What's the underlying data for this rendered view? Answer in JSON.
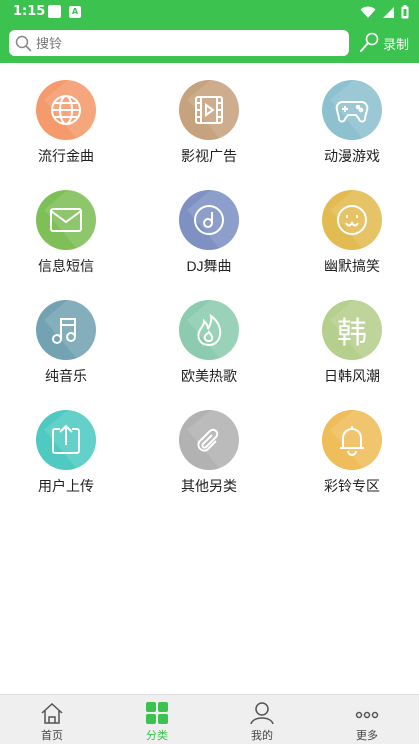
{
  "status_bar": {
    "time": "1:15",
    "notif_badge": "A"
  },
  "search": {
    "placeholder": "搜铃",
    "record_label": "录制"
  },
  "colors": {
    "brand": "#3cc24f",
    "active_nav": "#3cc24f"
  },
  "categories": [
    {
      "label": "流行金曲",
      "icon": "globe-icon",
      "color": "#f59a6c"
    },
    {
      "label": "影视广告",
      "icon": "film-icon",
      "color": "#c6a27f"
    },
    {
      "label": "动漫游戏",
      "icon": "gamepad-icon",
      "color": "#8ec1cf"
    },
    {
      "label": "信息短信",
      "icon": "mail-icon",
      "color": "#7fbf57"
    },
    {
      "label": "DJ舞曲",
      "icon": "disc-icon",
      "color": "#7f91c3"
    },
    {
      "label": "幽默搞笑",
      "icon": "smiley-icon",
      "color": "#e3bb53"
    },
    {
      "label": "纯音乐",
      "icon": "music-note-icon",
      "color": "#73a3b3"
    },
    {
      "label": "欧美热歌",
      "icon": "flame-icon",
      "color": "#8ccbb0"
    },
    {
      "label": "日韩风潮",
      "icon": "han-char-icon",
      "color": "#b5cf8c"
    },
    {
      "label": "用户上传",
      "icon": "upload-icon",
      "color": "#4ecac2"
    },
    {
      "label": "其他另类",
      "icon": "paperclip-icon",
      "color": "#b2b2b2"
    },
    {
      "label": "彩铃专区",
      "icon": "bell-icon",
      "color": "#efbd59"
    }
  ],
  "han_glyph": "韩",
  "bottom_nav": [
    {
      "label": "首页",
      "icon": "home-icon"
    },
    {
      "label": "分类",
      "icon": "grid-icon",
      "active": true
    },
    {
      "label": "我的",
      "icon": "user-icon"
    },
    {
      "label": "更多",
      "icon": "more-icon"
    }
  ]
}
